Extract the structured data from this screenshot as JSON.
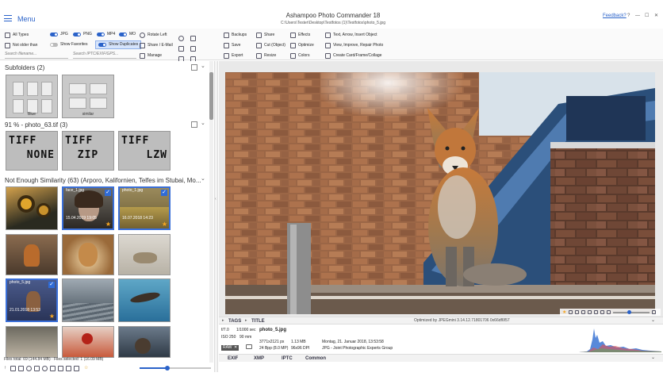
{
  "titlebar": {
    "menu_label": "Menu",
    "app_title": "Ashampoo Photo Commander 18",
    "path": "C:\\Users\\Tester\\Desktop\\Testfotos (1)\\Testfotos\\photo_5.jpg",
    "feedback_label": "Feedback?",
    "window_buttons": [
      "?",
      "—",
      "☐",
      "✕"
    ]
  },
  "filters": {
    "all_types": "All Types",
    "jpg": "JPG",
    "png": "PNG",
    "mp4": "MP4",
    "mov": "MO",
    "not_older": "Not older than",
    "show_favorites": "Show Favorites",
    "show_duplicates": "Show Duplicates",
    "search_filename_placeholder": "Search filename...",
    "search_iptc_placeholder": "Search IPTC/EXIF/GPS..."
  },
  "toolbar": {
    "rotate_left": "Rotate Left",
    "share_email": "Share / E-Mail",
    "manage": "Manage",
    "backups": "Backups",
    "share": "Share",
    "effects": "Effects",
    "text_arrow": "Text, Arrow, Insert Object",
    "save": "Save",
    "cut_object": "Cut (Object)",
    "optimize": "Optimize",
    "view_improve": "View, Improve, Repair Photo",
    "export": "Export",
    "resize": "Resize",
    "colors": "Colors",
    "create_card": "Create Card/Frame/Collage"
  },
  "groups": {
    "subfolders": {
      "title": "Subfolders  (2)",
      "labels": [
        "Blue",
        "similar"
      ]
    },
    "tiff": {
      "title": "91 %  -  photo_63.tif  (3)",
      "texts": [
        [
          "TIFF",
          "NONE"
        ],
        [
          "TIFF",
          "ZIP"
        ],
        [
          "TIFF",
          "LZW"
        ]
      ]
    },
    "similarity": {
      "title": "Not Enough Similarity  (63)  (Arporo, Kalifornien, Telfes im Stubai, Mo...",
      "captions": [
        {
          "name": "face_1.jpg",
          "date": "15.04.2019 19:05"
        },
        {
          "name": "photo_1.jpg",
          "date": "16.07.2018 14:23"
        },
        {
          "name": "photo_5.jpg",
          "date": "21.01.2018 13:53"
        }
      ]
    }
  },
  "status": {
    "files_total": "Files total: 69 (144.84 MB) · Files selected: 1 (16.09 MB)"
  },
  "preview": {
    "optimized_note": "Optimized by JPEGmini 3.14.12.71801706 0x66df6f57",
    "tabs": [
      "TAGS",
      "TITLE"
    ]
  },
  "info": {
    "aperture": "f/7.0",
    "shutter": "1/1000 sec",
    "iso": "ISO 250",
    "focal": "90 mm",
    "filename": "photo_5.jpg",
    "dimensions": "3771x2121 px",
    "bpp": "24 Bpp (8.0 MP)",
    "filesize": "1.13 MB",
    "dpi": "96x96 DPI",
    "date": "Montag, 21. Januar 2018, 13:53:58",
    "format": "JPG - Joint Photographic Experts Group",
    "badges": [
      "RAW",
      "✕"
    ]
  },
  "bottom_tabs": [
    "EXIF",
    "XMP",
    "IPTC",
    "Common"
  ],
  "colors": {
    "accent": "#2a62c9",
    "window_bg": "#ffffff",
    "preview_bg": "#e9e9e9"
  }
}
